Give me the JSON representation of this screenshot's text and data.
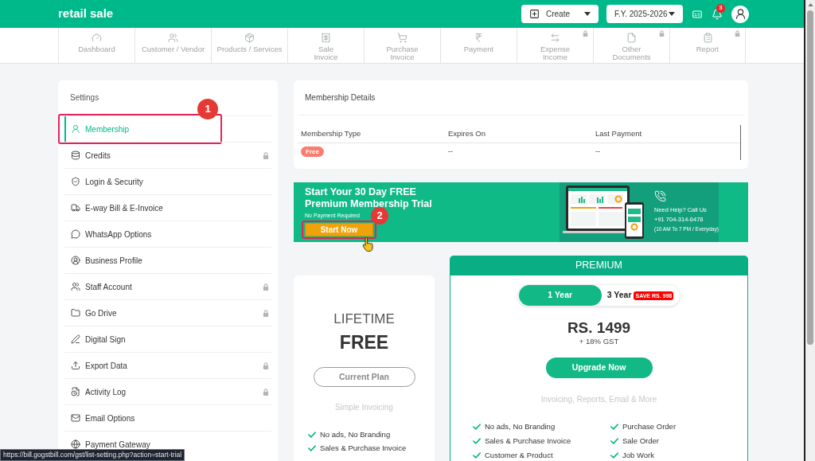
{
  "header": {
    "title": "retail sale",
    "create_label": "Create",
    "fiscal_year": "F.Y. 2025-2026",
    "notification_count": "3"
  },
  "nav": [
    {
      "label_lines": [
        "Dashboard"
      ],
      "selected": false,
      "locked": false
    },
    {
      "label_lines": [
        "Customer / Vendor"
      ],
      "selected": false,
      "locked": false
    },
    {
      "label_lines": [
        "Products / Services"
      ],
      "selected": false,
      "locked": false
    },
    {
      "label_lines": [
        "Sale",
        "Invoice"
      ],
      "selected": false,
      "locked": false
    },
    {
      "label_lines": [
        "Purchase",
        "Invoice"
      ],
      "selected": false,
      "locked": false
    },
    {
      "label_lines": [
        "Payment"
      ],
      "selected": false,
      "locked": false
    },
    {
      "label_lines": [
        "Expense",
        "Income"
      ],
      "selected": false,
      "locked": true
    },
    {
      "label_lines": [
        "Other",
        "Documents"
      ],
      "selected": false,
      "locked": true
    },
    {
      "label_lines": [
        "Report"
      ],
      "selected": false,
      "locked": true
    }
  ],
  "sidebar": {
    "title": "Settings",
    "items": [
      {
        "label": "Membership",
        "selected": true,
        "locked": false,
        "callout": "1"
      },
      {
        "label": "Credits",
        "selected": false,
        "locked": true
      },
      {
        "label": "Login & Security",
        "selected": false,
        "locked": false
      },
      {
        "label": "E-way Bill & E-Invoice",
        "selected": false,
        "locked": false
      },
      {
        "label": "WhatsApp Options",
        "selected": false,
        "locked": false
      },
      {
        "label": "Business Profile",
        "selected": false,
        "locked": false
      },
      {
        "label": "Staff Account",
        "selected": false,
        "locked": true
      },
      {
        "label": "Go Drive",
        "selected": false,
        "locked": true
      },
      {
        "label": "Digital Sign",
        "selected": false,
        "locked": false
      },
      {
        "label": "Export Data",
        "selected": false,
        "locked": true
      },
      {
        "label": "Activity Log",
        "selected": false,
        "locked": true
      },
      {
        "label": "Email Options",
        "selected": false,
        "locked": false
      },
      {
        "label": "Payment Gateway",
        "selected": false,
        "locked": false
      }
    ]
  },
  "membership_details": {
    "title": "Membership Details",
    "columns": [
      "Membership Type",
      "Expires On",
      "Last Payment"
    ],
    "rows": [
      {
        "membership_type": "Free",
        "expires_on": "--",
        "last_payment": "--"
      }
    ]
  },
  "trial_banner": {
    "headline_lines": [
      "Start Your 30 Day FREE",
      "Premium Membership Trial"
    ],
    "subtext": "No Payment Required",
    "button": "Start Now",
    "callout": "2",
    "help_title": "Need Help? Call Us",
    "phone": "+91 704-314-6478",
    "hours": "(10 AM To 7 PM / Everyday)"
  },
  "plans": {
    "lifetime": {
      "period": "LIFETIME",
      "price": "FREE",
      "button": "Current Plan",
      "tagline": "Simple Invoicing",
      "features": [
        "No ads, No Branding",
        "Sales & Purchase Invoice"
      ]
    },
    "premium": {
      "title": "PREMIUM",
      "durations": [
        {
          "label": "1 Year",
          "selected": true
        },
        {
          "label": "3 Year",
          "selected": false,
          "badge": "SAVE RS. 998"
        }
      ],
      "price": "RS. 1499",
      "tax": "+ 18% GST",
      "button": "Upgrade Now",
      "tagline": "Invoicing, Reports, Email & More",
      "features": [
        "No ads, No Branding",
        "Purchase Order",
        "Sales & Purchase Invoice",
        "Sale Order",
        "Customer & Product",
        "Job Work"
      ]
    }
  },
  "status_url": "https://bill.gogstbill.com/gst/list-setting.php?action=start-trial"
}
